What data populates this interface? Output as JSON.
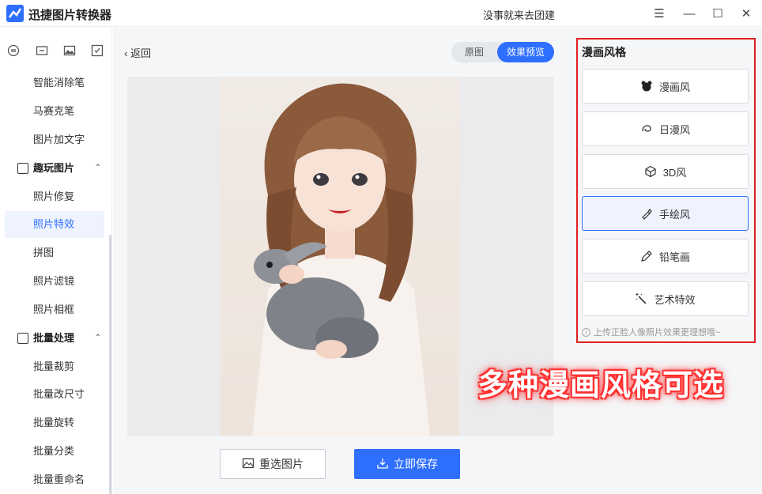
{
  "app": {
    "title": "迅捷图片转换器",
    "slogan": "没事就来去团建",
    "brand_color": "#2f6fff"
  },
  "window_controls": [
    "menu-icon",
    "minimize-icon",
    "maximize-icon",
    "close-icon"
  ],
  "sidebar": {
    "top_icons": [
      "convert-icon",
      "compress-icon",
      "image-icon",
      "edit-icon"
    ],
    "items_top": [
      {
        "label": "智能消除笔"
      },
      {
        "label": "马赛克笔"
      },
      {
        "label": "图片加文字"
      }
    ],
    "group_fun": {
      "label": "趣玩图片",
      "icon": "image-icon",
      "expanded": true
    },
    "items_fun": [
      {
        "label": "照片修复"
      },
      {
        "label": "照片特效",
        "active": true
      },
      {
        "label": "拼图"
      },
      {
        "label": "照片滤镜"
      },
      {
        "label": "照片相框"
      }
    ],
    "group_batch": {
      "label": "批量处理",
      "icon": "batch-icon",
      "expanded": true
    },
    "items_batch": [
      {
        "label": "批量裁剪"
      },
      {
        "label": "批量改尺寸"
      },
      {
        "label": "批量旋转"
      },
      {
        "label": "批量分类"
      },
      {
        "label": "批量重命名"
      }
    ]
  },
  "main": {
    "back_label": "返回",
    "toggle": {
      "original": "原图",
      "preview": "效果预览",
      "selected": "preview"
    },
    "reselect_label": "重选图片",
    "save_label": "立即保存"
  },
  "style_panel": {
    "title": "漫画风格",
    "styles": [
      {
        "label": "漫画风",
        "icon": "bear-icon"
      },
      {
        "label": "日漫风",
        "icon": "swirl-icon"
      },
      {
        "label": "3D风",
        "icon": "cube-icon"
      },
      {
        "label": "手绘风",
        "icon": "brush-icon",
        "active": true
      },
      {
        "label": "铅笔画",
        "icon": "pencil-icon"
      },
      {
        "label": "艺术特效",
        "icon": "magic-wand-icon"
      }
    ],
    "hint": "上传正脸人像照片效果更理想哦~"
  },
  "overlay_caption": "多种漫画风格可选"
}
